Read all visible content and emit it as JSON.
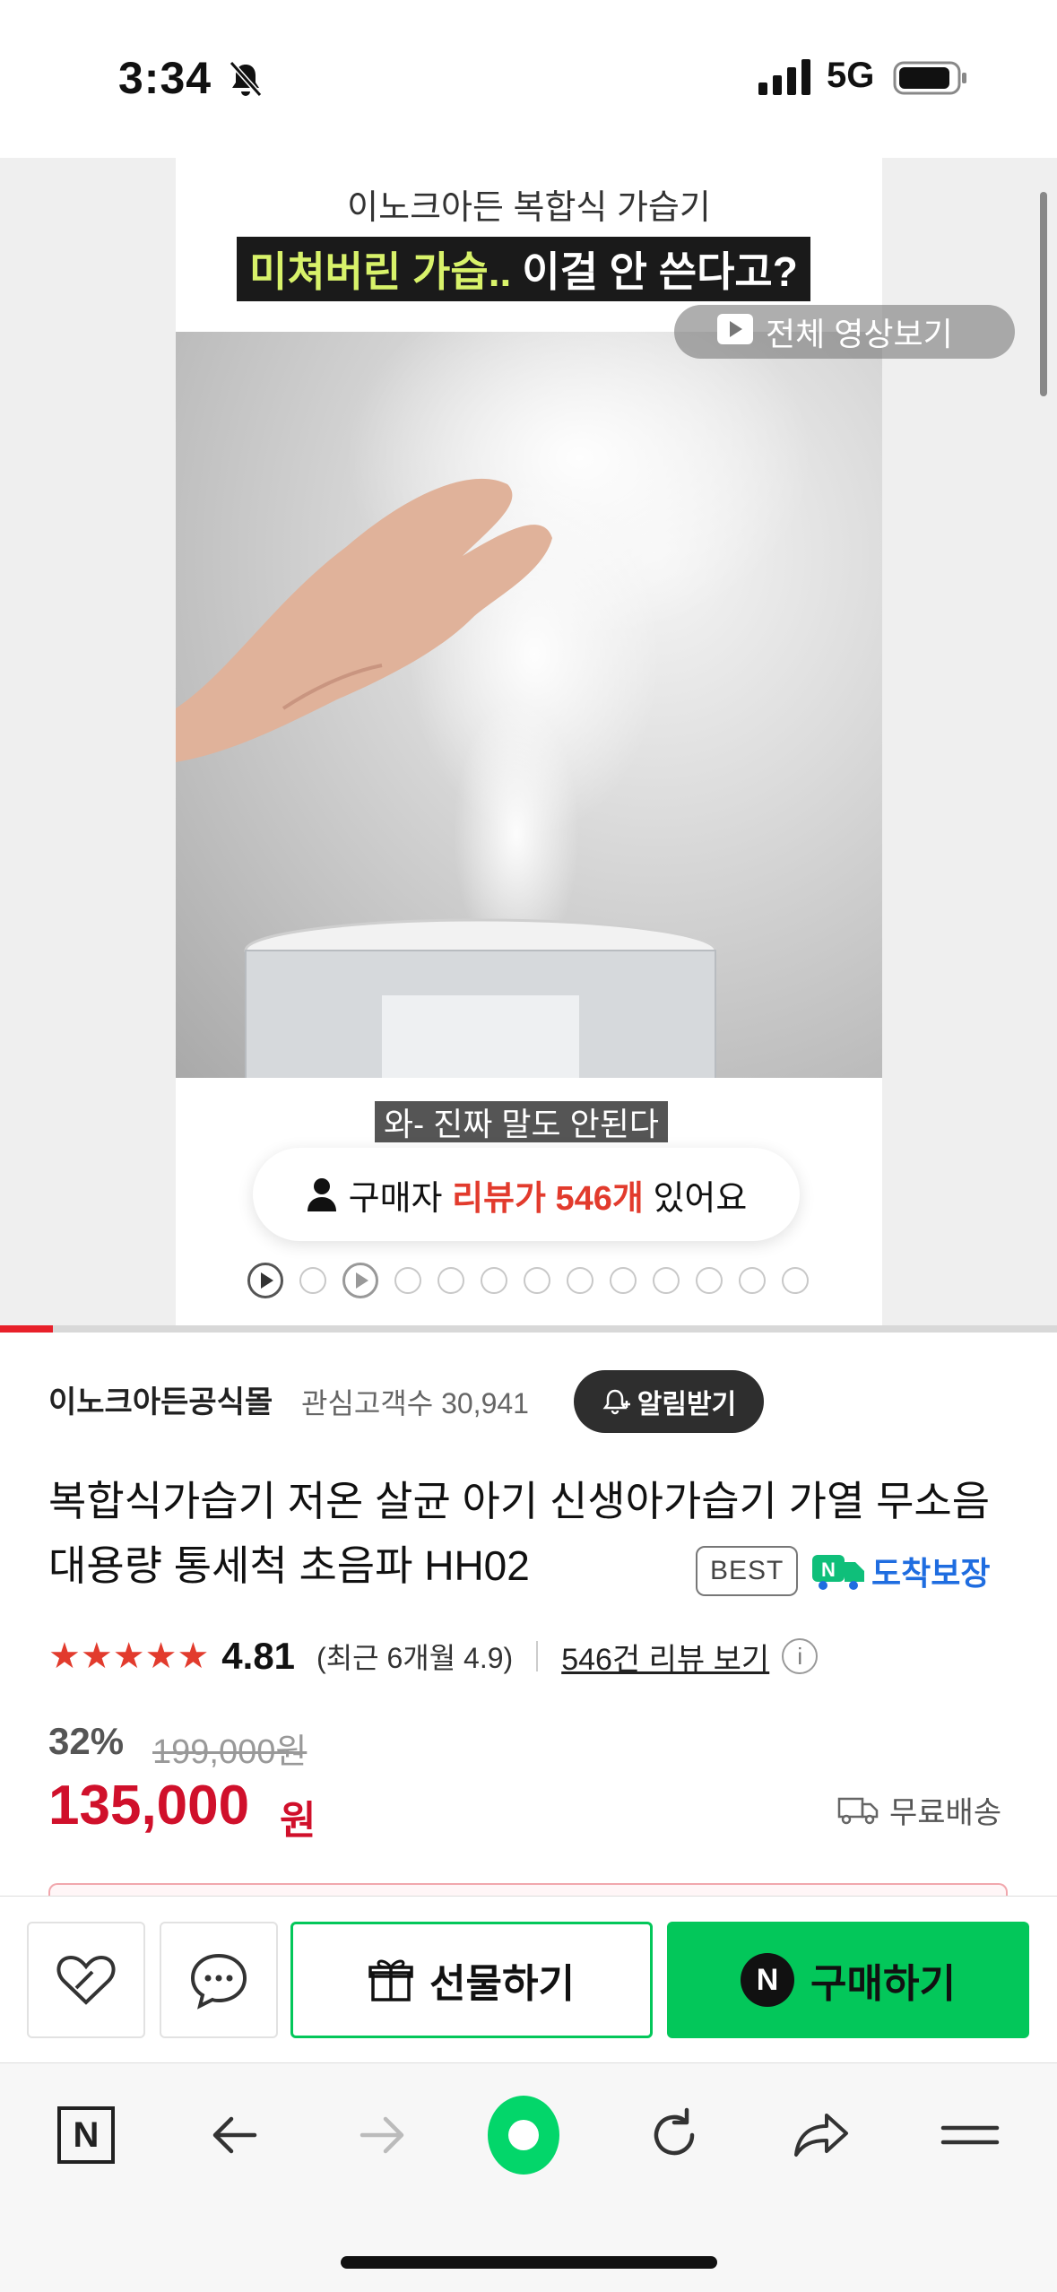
{
  "status_bar": {
    "time": "3:34",
    "network": "5G"
  },
  "hero": {
    "caption_top": "이노크아든 복합식 가습기",
    "headline_highlight": "미쳐버린 가습..",
    "headline_rest": "이걸 안 쓴다고?",
    "video_button": "전체 영상보기",
    "subtitle": "와- 진짜 말도 안된다",
    "review_prefix": "구매자",
    "review_highlight": "리뷰가 546개",
    "review_suffix": "있어요",
    "gallery_progress": 0.05
  },
  "store": {
    "name": "이노크아든공식몰",
    "followers_label": "관심고객수 30,941",
    "alarm_button": "알림받기"
  },
  "product": {
    "title": "복합식가습기 저온 살균 아기 신생아가습기 가열 무소음 대용량 통세척 초음파 HH02",
    "best_badge": "BEST",
    "arrival_label": "도착보장"
  },
  "rating": {
    "stars": "★★★★★",
    "value": "4.81",
    "recent": "(최근 6개월 4.9)",
    "review_link": "546건 리뷰 보기",
    "info": "i"
  },
  "price": {
    "discount": "32%",
    "original": "199,000원",
    "sale": "135,000",
    "unit": "원",
    "shipping": "무료배송"
  },
  "actions": {
    "gift": "선물하기",
    "buy": "구매하기",
    "buy_badge": "N"
  },
  "browser": {
    "home_badge": "N"
  },
  "colors": {
    "naver_green": "#03c75a",
    "price_red": "#d0102b",
    "star_red": "#e23b2d"
  }
}
